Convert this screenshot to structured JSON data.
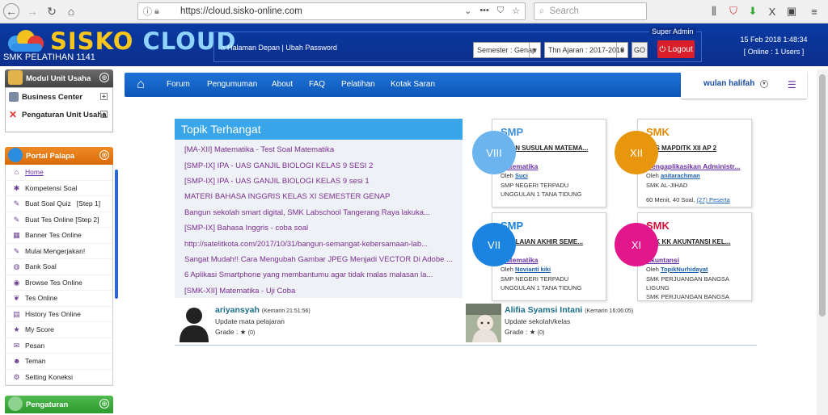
{
  "browser": {
    "url": "https://cloud.sisko-online.com",
    "search_placeholder": "Search"
  },
  "header": {
    "logo_text_1": "SISKO",
    "logo_text_2": "CLOUD",
    "school_name": "SMK PELATIHAN 1141",
    "links": "Halaman Depan | Ubah Password",
    "super_admin": "Super Admin",
    "semester": "Semester : Genap",
    "tahun_ajaran": "Thn Ajaran : 2017-2018",
    "go_label": "GO",
    "logout_label": "Logout",
    "date": "15 Feb 2018 1:48:34",
    "online": "[ Online : 1 Users ]"
  },
  "sidebar": {
    "unit_title": "Modul Unit Usaha",
    "unit_items": [
      "Business Center",
      "Pengaturan Unit Usaha"
    ],
    "portal_title": "Portal Palapa",
    "menu": [
      {
        "label": "Home",
        "icon": "home-icon",
        "glyph": "⌂"
      },
      {
        "label": "Kompetensi Soal",
        "icon": "asterisk-icon",
        "glyph": "✱"
      },
      {
        "label": "Buat Soal Quiz   [Step 1]",
        "icon": "edit-icon",
        "glyph": "✎"
      },
      {
        "label": "Buat Tes Online [Step 2]",
        "icon": "edit-icon",
        "glyph": "✎"
      },
      {
        "label": "Banner Tes Online",
        "icon": "grid-icon",
        "glyph": "▦"
      },
      {
        "label": "Mulai Mengerjakan!",
        "icon": "edit-icon",
        "glyph": "✎"
      },
      {
        "label": "Bank Soal",
        "icon": "bank-icon",
        "glyph": "◍"
      },
      {
        "label": "Browse Tes Online",
        "icon": "eye-icon",
        "glyph": "◉"
      },
      {
        "label": "Tes Online",
        "icon": "leaf-icon",
        "glyph": "❦"
      },
      {
        "label": "History Tes Online",
        "icon": "calendar-icon",
        "glyph": "▤"
      },
      {
        "label": "My Score",
        "icon": "star-icon",
        "glyph": "★"
      },
      {
        "label": "Pesan",
        "icon": "inbox-icon",
        "glyph": "✉"
      },
      {
        "label": "Teman",
        "icon": "user-icon",
        "glyph": "☻"
      },
      {
        "label": "Setting Koneksi",
        "icon": "gear-icon",
        "glyph": "⚙"
      }
    ],
    "pengaturan_title": "Pengaturan"
  },
  "mainnav": {
    "items": [
      "Forum",
      "Pengumuman",
      "About",
      "FAQ",
      "Pelatihan",
      "Kotak Saran"
    ],
    "user": "wulan halifah"
  },
  "topik": {
    "title": "Topik Terhangat",
    "items": [
      "[MA-XII] Matematika - Test Soal Matematika",
      "[SMP-IX] IPA - UAS GANJIL BIOLOGI KELAS 9 SESI 2",
      "[SMP-IX] IPA - UAS GANJIL BIOLOGI KELAS 9 sesi 1",
      "MATERI BAHASA INGGRIS KELAS XI SEMESTER GENAP",
      "Bangun sekolah smart digital, SMK Labschool Tangerang Raya lakuka...",
      "[SMP-IX] Bahasa Inggris - coba soal",
      "http://satelitkota.com/2017/10/31/bangun-semangat-kebersamaan-lab...",
      "Sangat Mudah!! Cara Mengubah Gambar JPEG Menjadi VECTOR Di Adobe ...",
      "6 Aplikasi Smartphone yang membantumu agar tidak malas malasan la...",
      "[SMK-XII] Matematika - Uji Coba"
    ]
  },
  "cards": [
    {
      "grade": "VIII",
      "level": "SMP",
      "title": "UJIAN SUSULAN MATEMA...",
      "subject": "Matematika",
      "oleh": "Oleh",
      "author": "Suci",
      "lines": [
        "SMP NEGERI TERPADU",
        "UNGGULAN 1 TANA TIDUNG"
      ],
      "color": "#6cb4ee",
      "level_color": "#3a8fd8"
    },
    {
      "grade": "XII",
      "level": "SMK",
      "title": "UAS MAPDITK XII AP 2",
      "subject": "Mengaplikasikan Administr...",
      "oleh": "Oleh",
      "author": "anitarachman",
      "lines": [
        "SMK AL-JIHAD"
      ],
      "meta": "60 Menit, 40 Soal,",
      "meta_link": "(27) Peserta",
      "color": "#e8960e",
      "level_color": "#e08a00"
    },
    {
      "grade": "VII",
      "level": "SMP",
      "title": "PENILAIAN AKHIR SEME...",
      "subject": "Matematika",
      "oleh": "Oleh",
      "author": "Novianti kiki",
      "lines": [
        "SMP NEGERI TERPADU",
        "UNGGULAN 1 TANA TIDUNG"
      ],
      "color": "#1b84e0",
      "level_color": "#1b84e0"
    },
    {
      "grade": "XI",
      "level": "SMK",
      "title": "UUK KK AKUNTANSI KEL...",
      "subject": "Akuntansi",
      "oleh": "Oleh",
      "author": "TopikNurhidayat",
      "lines": [
        "SMK PERJUANGAN BANGSA",
        "LIGUNG",
        "SMK PERJUANGAN BANGSA"
      ],
      "color": "#e3178c",
      "level_color": "#d0103a"
    }
  ],
  "activity": [
    {
      "name": "ariyansyah",
      "time": "(Kemarin 21:51:56)",
      "desc": "Update mata pelajaran",
      "grade": "Grade :",
      "score": "(0)"
    },
    {
      "name": "Alifia Syamsi Intani",
      "time": "(Kemarin 16:06:05)",
      "desc": "Update sekolah/kelas",
      "grade": "Grade :",
      "score": "(0)"
    }
  ]
}
